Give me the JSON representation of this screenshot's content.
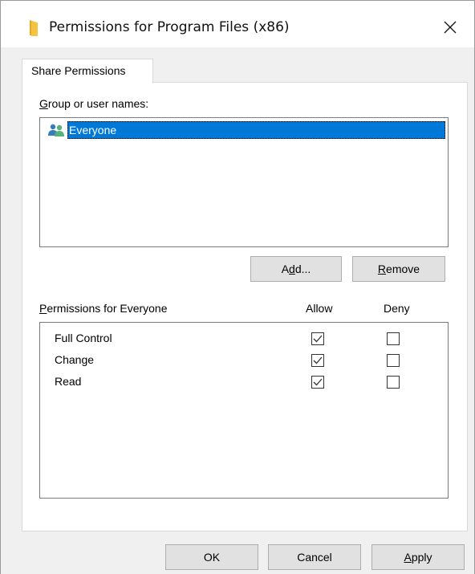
{
  "window": {
    "title": "Permissions for Program Files (x86)",
    "title_icon": "folder-icon",
    "close_icon": "close-icon"
  },
  "tabs": [
    {
      "label": "Share Permissions",
      "selected": true
    }
  ],
  "group_section": {
    "label_underlined": "G",
    "label_rest": "roup or user names:",
    "users": [
      {
        "name": "Everyone",
        "icon": "users-group-icon",
        "selected": true
      }
    ]
  },
  "buttons": {
    "add_pre": "A",
    "add_u": "d",
    "add_post": "d...",
    "remove_u": "R",
    "remove_post": "emove"
  },
  "permissions": {
    "header_u": "P",
    "header_rest": "ermissions for Everyone",
    "allow_label": "Allow",
    "deny_label": "Deny",
    "rows": [
      {
        "name": "Full Control",
        "allow": true,
        "deny": false
      },
      {
        "name": "Change",
        "allow": true,
        "deny": false
      },
      {
        "name": "Read",
        "allow": true,
        "deny": false
      }
    ]
  },
  "footer": {
    "ok_label": "OK",
    "cancel_label": "Cancel",
    "apply_u": "A",
    "apply_rest": "pply"
  },
  "colors": {
    "selection": "#0078d7",
    "check": "#333333",
    "folder": "#f5c342"
  }
}
